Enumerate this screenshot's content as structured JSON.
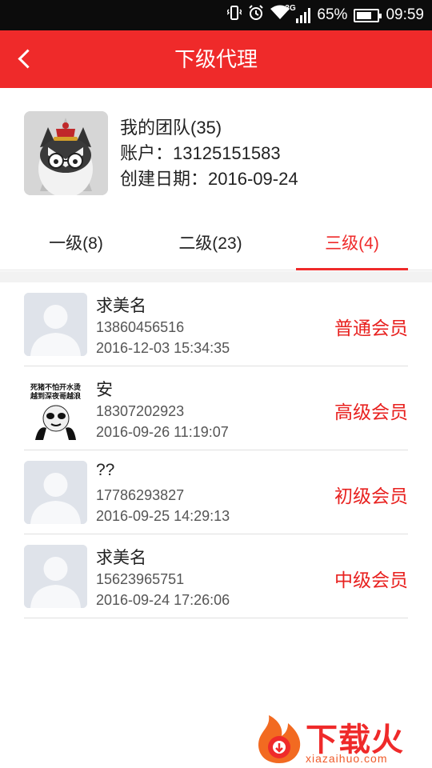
{
  "status_bar": {
    "network": "3G",
    "battery": "65%",
    "time": "09:59"
  },
  "nav": {
    "title": "下级代理"
  },
  "profile": {
    "team": "我的团队(35)",
    "account_label": "账户：",
    "account": "13125151583",
    "created_label": "创建日期：",
    "created": "2016-09-24"
  },
  "tabs": [
    {
      "label": "一级(8)",
      "active": false
    },
    {
      "label": "二级(23)",
      "active": false
    },
    {
      "label": "三级(4)",
      "active": true
    }
  ],
  "members": [
    {
      "name": "求美名",
      "phone": "13860456516",
      "date": "2016-12-03 15:34:35",
      "level": "普通会员",
      "avatar": "default-avatar"
    },
    {
      "name": "安",
      "phone": "18307202923",
      "date": "2016-09-26 11:19:07",
      "level": "高级会员",
      "avatar": "panda-meme-avatar",
      "avatar_text": [
        "死猪不怕开水烫",
        "越到深夜哥越浪"
      ]
    },
    {
      "name": "??",
      "phone": "17786293827",
      "date": "2016-09-25 14:29:13",
      "level": "初级会员",
      "avatar": "default-avatar"
    },
    {
      "name": "求美名",
      "phone": "15623965751",
      "date": "2016-09-24 17:26:06",
      "level": "中级会员",
      "avatar": "default-avatar"
    }
  ],
  "watermark": {
    "title": "下载火",
    "url": "xiazaihuo.com"
  },
  "colors": {
    "accent": "#ef2a2a",
    "level_text": "#e8211f",
    "status_bar": "#0c0c0c"
  }
}
